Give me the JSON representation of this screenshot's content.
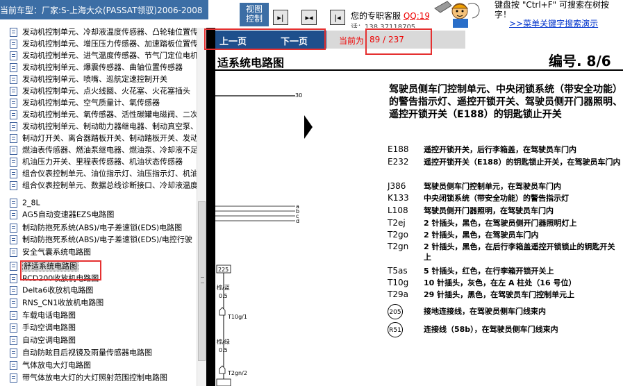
{
  "top": {
    "model": "当前车型：厂家:S-上海大众(PASSAT领驭)2006-2008",
    "view_label_1": "视图",
    "view_label_2": "控制",
    "service_text": "您的专职客服",
    "service_qq": "QQ:19",
    "service_sub": "话：138 37118705",
    "shortcut_1": "键盘按 \"Ctrl+F\" 可搜索在树按",
    "shortcut_2": "字！",
    "shortcut_link": ">>菜单关键字搜索演示"
  },
  "tree": {
    "items": [
      "发动机控制单元、冷却液温度传感器、凸轮轴位置传感",
      "发动机控制单元、增压压力传感器、加速踏板位置传感",
      "发动机控制单元、进气温度传感器、节气门定位电机",
      "发动机控制单元、爆震传感器、曲轴位置传感器",
      "发动机控制单元、喷嘴、巡航定速控制开关",
      "发动机控制单元、点火线圈、火花塞、火花塞插头",
      "发动机控制单元、空气质量计、氧传感器",
      "发动机控制单元、氧传感器、活性碳罐电磁阀、二次",
      "发动机控制单元、制动助力器继电器、制动真空泵、",
      "制动灯开关、离合器踏板开关、制动踏板开关、发动",
      "燃油表传感器、燃油泵继电器、燃油泵、冷却液不足",
      "机油压力开关、里程表传感器、机油状态传感器",
      "组合仪表控制单元、油位指示灯、油压指示灯、机油",
      "组合仪表控制单元、数据总线诊断接口、冷却液温度",
      "2_8L",
      "AG5自动变速器EZS电路图",
      "制动防抱死系统(ABS)/电子差速锁(EDS)电路图",
      "制动防抱死系统(ABS)/电子差速锁(EDS)/电控行驶",
      "安全气囊系统电路图",
      "舒适系统电路图",
      "RCD200收放机电路图",
      "Delta6收放机电路图",
      "RNS_CN1收放机电路图",
      "车载电话电路图",
      "手动空调电路图",
      "自动空调电路图",
      "自动防眩目后视镜及雨量传感器电路图",
      "气体放电大灯电路图",
      "带气体放电大灯的大灯照射范围控制电路图"
    ]
  },
  "viewer": {
    "prev": "上一页",
    "next": "下一页",
    "counter_label": "当前为",
    "counter": "89 / 237",
    "title": "适系统电路图",
    "number": "编号. 8/6",
    "heading": "驾驶员侧车门控制单元、中央闭锁系统（带安全功能）的警告指示灯、遥控开锁开关、驾驶员侧开门器照明、遥控开锁开关（E188）的钥匙锁止开关",
    "legend": [
      {
        "code": "E188",
        "desc": "遥控开锁开关，后行李箱盖，在驾驶员车门内"
      },
      {
        "code": "E232",
        "desc": "遥控开锁开关（E188）的钥匙锁止开关，在驾驶员车门内"
      },
      {
        "code": "J386",
        "desc": "驾驶员侧车门控制单元，在驾驶员车门内"
      },
      {
        "code": "K133",
        "desc": "中央闭锁系统（带安全功能）的警告指示灯"
      },
      {
        "code": "L108",
        "desc": "驾驶员侧开门器照明，在驾驶员车门内"
      },
      {
        "code": "T2ej",
        "desc": "2 针插头，黑色，在驾驶员侧开门器照明灯上"
      },
      {
        "code": "T2go",
        "desc": "2 针插头，黑色，在驾驶员车门内"
      },
      {
        "code": "T2gn",
        "desc": "2 针插头，黑色，在后行李箱盖遥控开锁锁止的钥匙开关上"
      },
      {
        "code": "T5as",
        "desc": "5 针插头，红色，在行李箱开锁开关上"
      },
      {
        "code": "T10g",
        "desc": "10 针插头，灰色，在左 A 柱处（16 号位）"
      },
      {
        "code": "T29a",
        "desc": "29 针插头，黑色，在驾驶员车门控制单元上"
      },
      {
        "code": "205",
        "desc": "接地连接线，在驾驶员侧车门线束内"
      },
      {
        "code": "R51",
        "desc": "连接线（58b），在驾驶员侧车门线束内"
      }
    ]
  },
  "diagram": {
    "bus_30": "30",
    "bus_a": "a",
    "bus_b": "b",
    "bus_c": "c",
    "bus_d": "d",
    "box_225": "225",
    "wire_1": "棕/蓝",
    "wire_1_size": "0.5",
    "conn_1": "T10g/1",
    "wire_2": "棕/绿",
    "wire_2_size": "0.5",
    "conn_2": "T2gn/2"
  }
}
